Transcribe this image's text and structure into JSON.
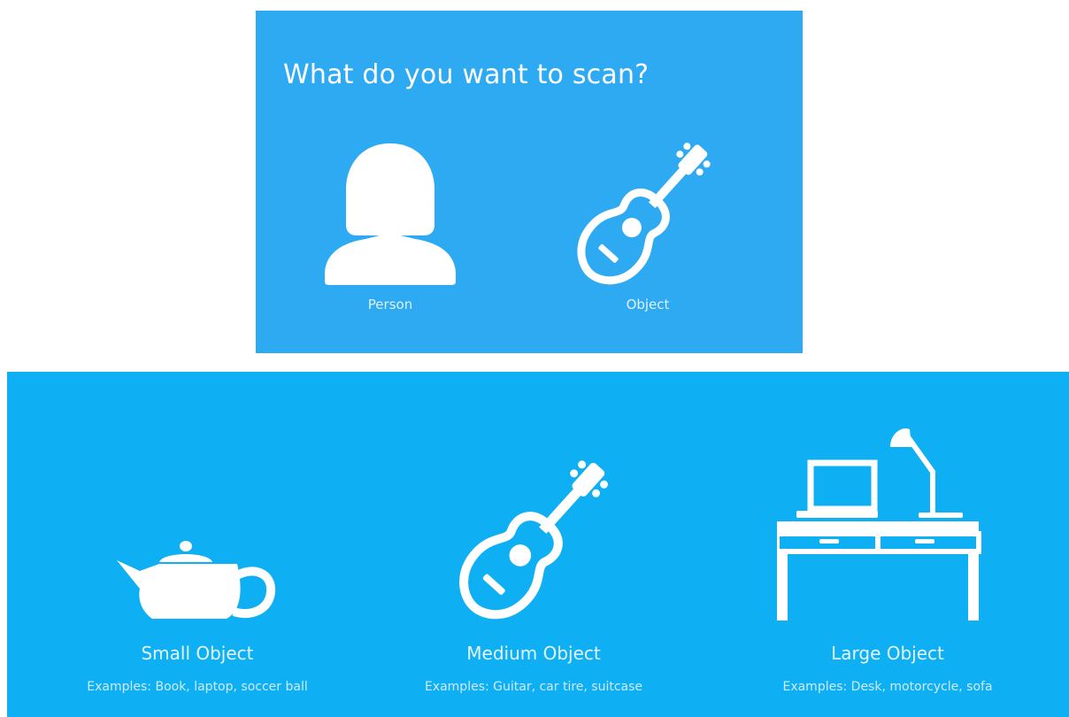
{
  "top_panel": {
    "title": "What do you want to scan?",
    "options": [
      {
        "label": "Person",
        "icon": "person-icon"
      },
      {
        "label": "Object",
        "icon": "guitar-icon"
      }
    ]
  },
  "bottom_panel": {
    "cards": [
      {
        "title": "Small Object",
        "examples": "Examples: Book, laptop, soccer ball",
        "icon": "teapot-icon"
      },
      {
        "title": "Medium Object",
        "examples": "Examples: Guitar, car tire, suitcase",
        "icon": "guitar-icon"
      },
      {
        "title": "Large Object",
        "examples": "Examples: Desk, motorcycle, sofa",
        "icon": "desk-icon"
      }
    ]
  },
  "colors": {
    "top_panel_bg": "#2eaaf3",
    "bottom_panel_bg": "#0fb0f3",
    "foreground": "#ffffff"
  }
}
